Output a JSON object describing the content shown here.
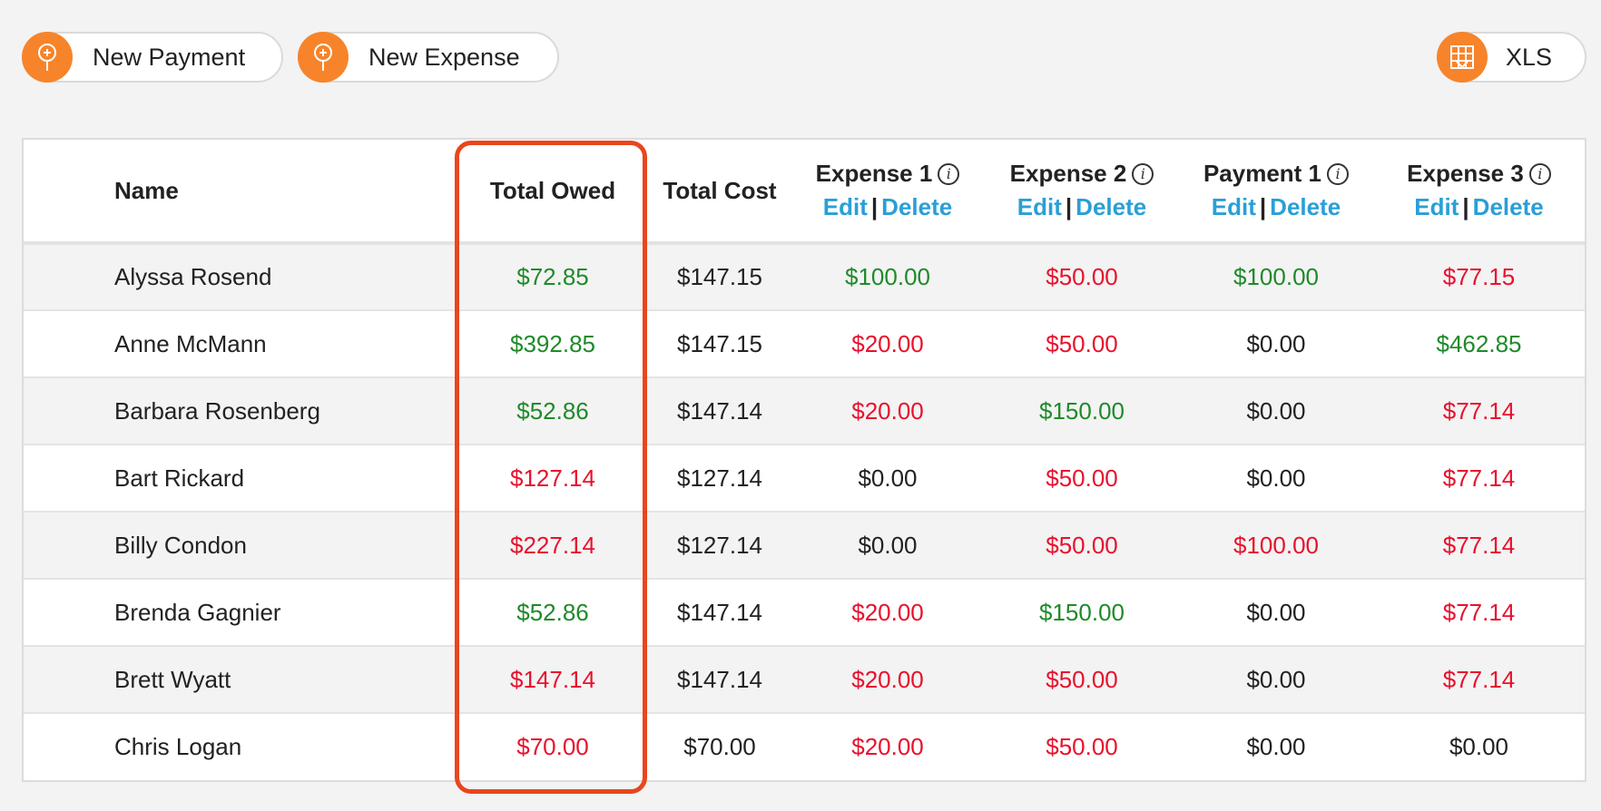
{
  "toolbar": {
    "new_payment_label": "New Payment",
    "new_expense_label": "New Expense",
    "xls_label": "XLS",
    "accent_color": "#f7842a"
  },
  "table": {
    "headers": {
      "name": "Name",
      "total_owed": "Total Owed",
      "total_cost": "Total Cost",
      "cols": [
        {
          "title": "Expense 1",
          "edit": "Edit",
          "sep": "|",
          "delete": "Delete"
        },
        {
          "title": "Expense 2",
          "edit": "Edit",
          "sep": "|",
          "delete": "Delete"
        },
        {
          "title": "Payment 1",
          "edit": "Edit",
          "sep": "|",
          "delete": "Delete"
        },
        {
          "title": "Expense 3",
          "edit": "Edit",
          "sep": "|",
          "delete": "Delete"
        }
      ]
    },
    "rows": [
      {
        "name": "Alyssa Rosend",
        "owed": {
          "v": "$72.85",
          "c": "g"
        },
        "cost": "$147.15",
        "cells": [
          {
            "v": "$100.00",
            "c": "g"
          },
          {
            "v": "$50.00",
            "c": "r"
          },
          {
            "v": "$100.00",
            "c": "g"
          },
          {
            "v": "$77.15",
            "c": "r"
          }
        ]
      },
      {
        "name": "Anne McMann",
        "owed": {
          "v": "$392.85",
          "c": "g"
        },
        "cost": "$147.15",
        "cells": [
          {
            "v": "$20.00",
            "c": "r"
          },
          {
            "v": "$50.00",
            "c": "r"
          },
          {
            "v": "$0.00",
            "c": "k"
          },
          {
            "v": "$462.85",
            "c": "g"
          }
        ]
      },
      {
        "name": "Barbara Rosenberg",
        "owed": {
          "v": "$52.86",
          "c": "g"
        },
        "cost": "$147.14",
        "cells": [
          {
            "v": "$20.00",
            "c": "r"
          },
          {
            "v": "$150.00",
            "c": "g"
          },
          {
            "v": "$0.00",
            "c": "k"
          },
          {
            "v": "$77.14",
            "c": "r"
          }
        ]
      },
      {
        "name": "Bart Rickard",
        "owed": {
          "v": "$127.14",
          "c": "r"
        },
        "cost": "$127.14",
        "cells": [
          {
            "v": "$0.00",
            "c": "k"
          },
          {
            "v": "$50.00",
            "c": "r"
          },
          {
            "v": "$0.00",
            "c": "k"
          },
          {
            "v": "$77.14",
            "c": "r"
          }
        ]
      },
      {
        "name": "Billy Condon",
        "owed": {
          "v": "$227.14",
          "c": "r"
        },
        "cost": "$127.14",
        "cells": [
          {
            "v": "$0.00",
            "c": "k"
          },
          {
            "v": "$50.00",
            "c": "r"
          },
          {
            "v": "$100.00",
            "c": "r"
          },
          {
            "v": "$77.14",
            "c": "r"
          }
        ]
      },
      {
        "name": "Brenda Gagnier",
        "owed": {
          "v": "$52.86",
          "c": "g"
        },
        "cost": "$147.14",
        "cells": [
          {
            "v": "$20.00",
            "c": "r"
          },
          {
            "v": "$150.00",
            "c": "g"
          },
          {
            "v": "$0.00",
            "c": "k"
          },
          {
            "v": "$77.14",
            "c": "r"
          }
        ]
      },
      {
        "name": "Brett Wyatt",
        "owed": {
          "v": "$147.14",
          "c": "r"
        },
        "cost": "$147.14",
        "cells": [
          {
            "v": "$20.00",
            "c": "r"
          },
          {
            "v": "$50.00",
            "c": "r"
          },
          {
            "v": "$0.00",
            "c": "k"
          },
          {
            "v": "$77.14",
            "c": "r"
          }
        ]
      },
      {
        "name": "Chris Logan",
        "owed": {
          "v": "$70.00",
          "c": "r"
        },
        "cost": "$70.00",
        "cells": [
          {
            "v": "$20.00",
            "c": "r"
          },
          {
            "v": "$50.00",
            "c": "r"
          },
          {
            "v": "$0.00",
            "c": "k"
          },
          {
            "v": "$0.00",
            "c": "k"
          }
        ]
      }
    ]
  },
  "colors": {
    "positive": "#1f8a2a",
    "negative": "#e8112d",
    "link": "#2a9fd6",
    "highlight": "#e8461e"
  }
}
